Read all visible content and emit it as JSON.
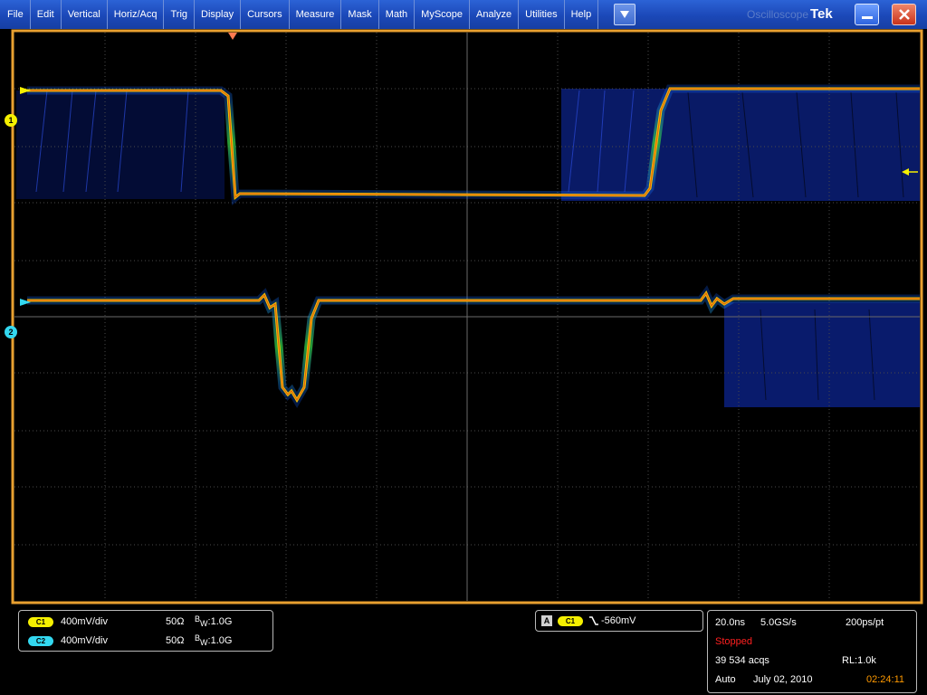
{
  "menu": [
    "File",
    "Edit",
    "Vertical",
    "Horiz/Acq",
    "Trig",
    "Display",
    "Cursors",
    "Measure",
    "Mask",
    "Math",
    "MyScope",
    "Analyze",
    "Utilities",
    "Help"
  ],
  "titlebar": {
    "ghost_text": "Oscilloscope",
    "brand": "Tek"
  },
  "icons": {
    "dropdown": "chevron-down-icon",
    "minimize": "minimize-icon",
    "close": "close-icon",
    "trigger_position": "trigger-position-icon",
    "trigger_level": "trigger-level-arrow-icon"
  },
  "colors": {
    "frame": "#e8a030",
    "ch1": "#f5f000",
    "ch2": "#33d8f0",
    "persistence": "#0a1e78",
    "trace": "#e87a20",
    "stopped": "#ff2020",
    "time": "#ff9a00"
  },
  "markers": {
    "ch1": "1",
    "ch2": "2"
  },
  "channels": [
    {
      "badge": "C1",
      "scale": "400mV/div",
      "impedance": "50Ω",
      "bw_prefix": "B",
      "bw_sub": "W",
      "bw_value": ":1.0G"
    },
    {
      "badge": "C2",
      "scale": "400mV/div",
      "impedance": "50Ω",
      "bw_prefix": "B",
      "bw_sub": "W",
      "bw_value": ":1.0G"
    }
  ],
  "trigger": {
    "mode": "A",
    "source": "C1",
    "level": "-560mV"
  },
  "acquisition": {
    "timebase": "20.0ns",
    "sample_rate": "5.0GS/s",
    "resolution": "200ps/pt",
    "status": "Stopped",
    "acqs": "39 534 acqs",
    "record_length": "RL:1.0k",
    "trigger_mode": "Auto",
    "date": "July 02, 2010",
    "time": "02:24:11"
  }
}
